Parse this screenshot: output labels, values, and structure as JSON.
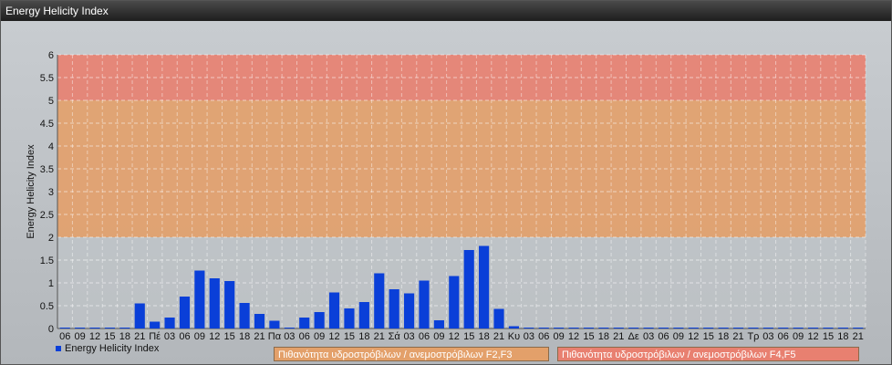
{
  "window": {
    "title": "Energy Helicity Index"
  },
  "colors": {
    "bar": "#0a3fd8",
    "band_low": "#c2c6ca",
    "band_f2f3": "#e3a06a",
    "band_f4f5": "#e88070"
  },
  "chart_data": {
    "type": "bar",
    "title": "",
    "ylabel": "Energy Helicity Index",
    "xlabel": "",
    "ylim": [
      0,
      6
    ],
    "yticks": [
      "0",
      "0.5",
      "1",
      "1.5",
      "2",
      "2.5",
      "3",
      "3.5",
      "4",
      "4.5",
      "5",
      "5.5",
      "6"
    ],
    "grid": true,
    "legend_position": "bottom-left",
    "bands": [
      {
        "from": 2,
        "to": 5,
        "label": "Πιθανότητα υδροστρόβιλων / ανεμοστρόβιλων F2,F3"
      },
      {
        "from": 5,
        "to": 6,
        "label": "Πιθανότητα υδροστρόβιλων / ανεμοστρόβιλων F4,F5"
      }
    ],
    "categories": [
      "06",
      "09",
      "12",
      "15",
      "18",
      "21",
      "Πέ",
      "03",
      "06",
      "09",
      "12",
      "15",
      "18",
      "21",
      "Πα",
      "03",
      "06",
      "09",
      "12",
      "15",
      "18",
      "21",
      "Σά",
      "03",
      "06",
      "09",
      "12",
      "15",
      "18",
      "21",
      "Κυ",
      "03",
      "06",
      "09",
      "12",
      "15",
      "18",
      "21",
      "Δε",
      "03",
      "06",
      "09",
      "12",
      "15",
      "18",
      "21",
      "Τρ",
      "03",
      "06",
      "09",
      "12",
      "15",
      "18",
      "21"
    ],
    "series": [
      {
        "name": "Energy Helicity Index",
        "values": [
          0.01,
          0.01,
          0.01,
          0.01,
          0.02,
          0.55,
          0.15,
          0.24,
          0.7,
          1.27,
          1.1,
          1.04,
          0.56,
          0.32,
          0.17,
          0.01,
          0.24,
          0.36,
          0.79,
          0.44,
          0.58,
          1.21,
          0.86,
          0.77,
          1.05,
          0.18,
          1.15,
          1.72,
          1.81,
          0.43,
          0.05,
          0.01,
          0.01,
          0.01,
          0.01,
          0.01,
          0.01,
          0.01,
          0.01,
          0.01,
          0.01,
          0.01,
          0.01,
          0.01,
          0.01,
          0.01,
          0.01,
          0.01,
          0.01,
          0.01,
          0.01,
          0.01,
          0.01,
          0.01
        ]
      }
    ]
  }
}
